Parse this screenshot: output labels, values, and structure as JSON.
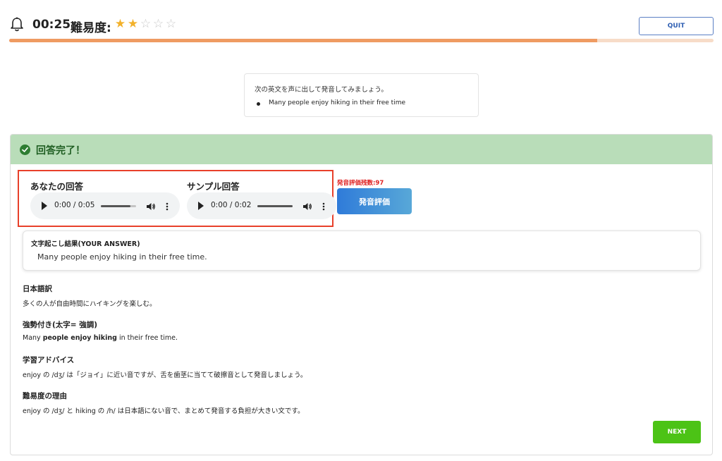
{
  "header": {
    "timer": "00:25",
    "difficulty_label": "難易度:",
    "stars": {
      "filled": 2,
      "total": 5
    },
    "quit_label": "QUIT",
    "progress_fraction": 0.835
  },
  "prompt": {
    "instruction": "次の英文を声に出して発音してみましょう。",
    "sentence": "Many people enjoy hiking in their free time"
  },
  "result": {
    "title": "回答完了！",
    "your_answer_label": "あなたの回答",
    "your_answer_time": "0:00 / 0:05",
    "sample_answer_label": "サンプル回答",
    "sample_answer_time": "0:00 / 0:02",
    "remaining_label": "発音評価残数:97",
    "evaluate_button": "発音評価",
    "transcript_title": "文字起こし結果(YOUR ANSWER)",
    "transcript_text": "Many people enjoy hiking in their free time."
  },
  "sections": {
    "translation_title": "日本語訳",
    "translation_body": "多くの人が自由時間にハイキングを楽しむ。",
    "stress_title": "強勢付き(太字= 強調)",
    "stress_parts": [
      "Many ",
      "people enjoy hiking",
      " in their free time."
    ],
    "advice_title": "学習アドバイス",
    "advice_body": "enjoy の /dʒ/ は「ジョイ」に近い音ですが、舌を歯茎に当てて破擦音として発音しましょう。",
    "reason_title": "難易度の理由",
    "reason_body": "enjoy の /dʒ/ と hiking の /h/ は日本語にない音で、まとめて発音する負担が大きい文です。"
  },
  "footer": {
    "next_label": "NEXT"
  },
  "colors": {
    "progress": "#ef9b62",
    "progress_track": "#f7dcc8",
    "success_bg": "#b9ddb9",
    "highlight_border": "#e8402a",
    "next_button": "#4cc316",
    "eval_button": "#2f7bd9",
    "warning_text": "#e02020",
    "star_on": "#f2b12b"
  },
  "icons": [
    "bell-icon",
    "star-icon",
    "check-circle-icon",
    "play-icon",
    "volume-icon",
    "more-vert-icon"
  ]
}
